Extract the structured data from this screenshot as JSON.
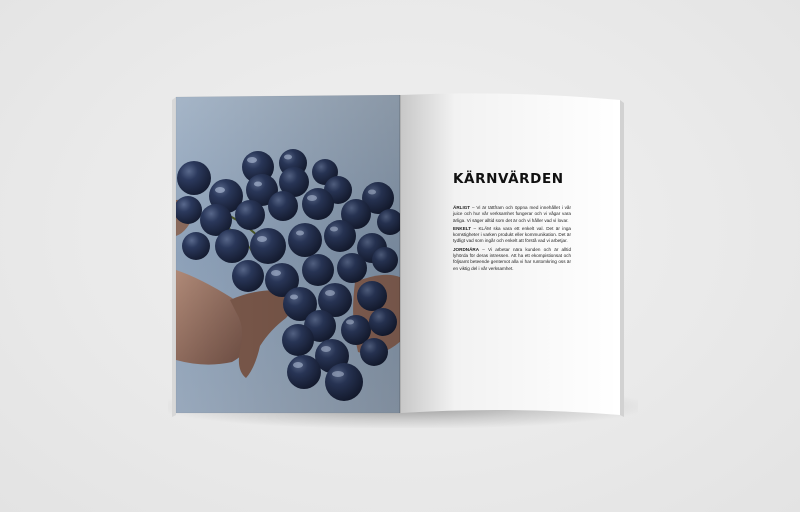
{
  "spread": {
    "left_page": {
      "photo_alt": "bunch of dark blue grapes held in hands"
    },
    "right_page": {
      "heading": "KÄRNVÄRDEN",
      "values": [
        {
          "term": "ÄRLIGT",
          "text": " – Vi är tättfram och öppna med innehållet i vår juice och hur vår verksamhet fungerar och vi vågar vara ärliga. Vi säger alltid som det är och vi håller vad vi lovar."
        },
        {
          "term": "ENKELT",
          "text": " – KLÄM ska vara ett enkelt val. Det är inga komstigheter i varken produkt eller kommunikation. Det är tydligt vad som ingår och enkelt att förstå vad vi arbetjar."
        },
        {
          "term": "JORDNÄRA",
          "text": " – Vi arbetar nära kunden och är alltid lyhörda för deras intressen. Att ha ett ekompistionsat och följsamt beteende gentemot alla vi har runtomkring oss är en viktig del i vår verksamhet."
        }
      ]
    }
  },
  "colors": {
    "background": "#ececec",
    "page": "#ffffff",
    "photo_bg": "#8fa3bb",
    "grape": "#1f2a47"
  }
}
